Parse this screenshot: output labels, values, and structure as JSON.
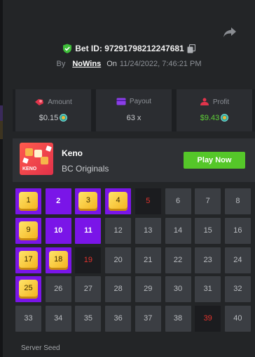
{
  "bet": {
    "id_label": "Bet ID: 97291798212247681",
    "by_label": "By",
    "user": "NoWins",
    "on_label": "On",
    "datetime": "11/24/2022, 7:46:21 PM"
  },
  "stats": {
    "amount_label": "Amount",
    "amount_value": "$0.15",
    "payout_label": "Payout",
    "payout_value": "63 x",
    "profit_label": "Profit",
    "profit_value": "$9.43"
  },
  "game": {
    "thumb_label": "KENO",
    "name": "Keno",
    "provider": "BC Originals",
    "play_label": "Play Now"
  },
  "keno_grid": {
    "numbers": [
      "1",
      "2",
      "3",
      "4",
      "5",
      "6",
      "7",
      "8",
      "9",
      "10",
      "11",
      "12",
      "13",
      "14",
      "15",
      "16",
      "17",
      "18",
      "19",
      "20",
      "21",
      "22",
      "23",
      "24",
      "25",
      "26",
      "27",
      "28",
      "29",
      "30",
      "31",
      "32",
      "33",
      "34",
      "35",
      "36",
      "37",
      "38",
      "39",
      "40"
    ],
    "states": [
      "hit",
      "pick",
      "hit",
      "hit",
      "miss",
      "",
      "",
      "",
      "hit",
      "pick",
      "pick",
      "",
      "",
      "",
      "",
      "",
      "hit",
      "hit",
      "miss",
      "",
      "",
      "",
      "",
      "",
      "hit",
      "",
      "",
      "",
      "",
      "",
      "",
      "",
      "",
      "",
      "",
      "",
      "",
      "",
      "miss",
      ""
    ]
  },
  "footer": {
    "seed_label": "Server Seed"
  },
  "colors": {
    "accent_purple": "#7a15e8",
    "play_green": "#55c729",
    "profit_green": "#5fd038",
    "miss_red": "#e2332d",
    "gem_gold": "#f3b21c"
  },
  "icons": [
    "share-icon",
    "shield-check-icon",
    "copy-icon",
    "amount-icon",
    "payout-icon",
    "profit-icon",
    "coin-icon"
  ]
}
